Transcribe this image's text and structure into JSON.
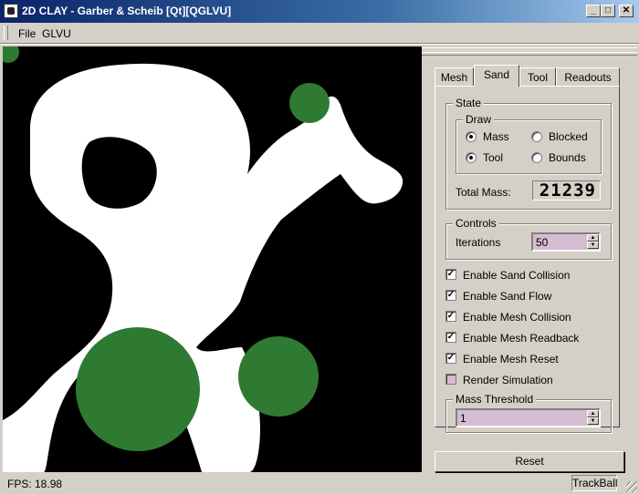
{
  "window": {
    "title": "2D CLAY - Garber & Scheib [Qt][QGLVU]",
    "controls": {
      "minimize": "_",
      "maximize": "□",
      "close": "✕"
    }
  },
  "menu": {
    "file": "File",
    "glvu": "GLVU"
  },
  "tabs": [
    "Mesh",
    "Sand",
    "Tool",
    "Readouts"
  ],
  "active_tab": "Sand",
  "state_group": {
    "title": "State",
    "draw_group": {
      "title": "Draw",
      "options": [
        {
          "label": "Mass",
          "selected": true
        },
        {
          "label": "Blocked",
          "selected": false
        },
        {
          "label": "Tool",
          "selected": true
        },
        {
          "label": "Bounds",
          "selected": false
        }
      ]
    },
    "total_mass_label": "Total Mass:",
    "total_mass_value": "21239"
  },
  "controls_group": {
    "title": "Controls",
    "iterations_label": "Iterations",
    "iterations_value": "50"
  },
  "checkboxes": [
    {
      "label": "Enable Sand Collision",
      "checked": true
    },
    {
      "label": "Enable Sand Flow",
      "checked": true
    },
    {
      "label": "Enable Mesh Collision",
      "checked": true
    },
    {
      "label": "Enable Mesh Readback",
      "checked": true
    },
    {
      "label": "Enable Mesh Reset",
      "checked": true
    },
    {
      "label": "Render Simulation",
      "checked": false
    }
  ],
  "mass_threshold": {
    "title": "Mass Threshold",
    "value": "1"
  },
  "reset_button": "Reset",
  "status": {
    "fps": "FPS: 18.98",
    "mode": "TrackBall"
  },
  "colors": {
    "clay": "#ffffff",
    "background": "#000000",
    "tool": "#2f7a32",
    "title_bar": "#0a246a"
  }
}
